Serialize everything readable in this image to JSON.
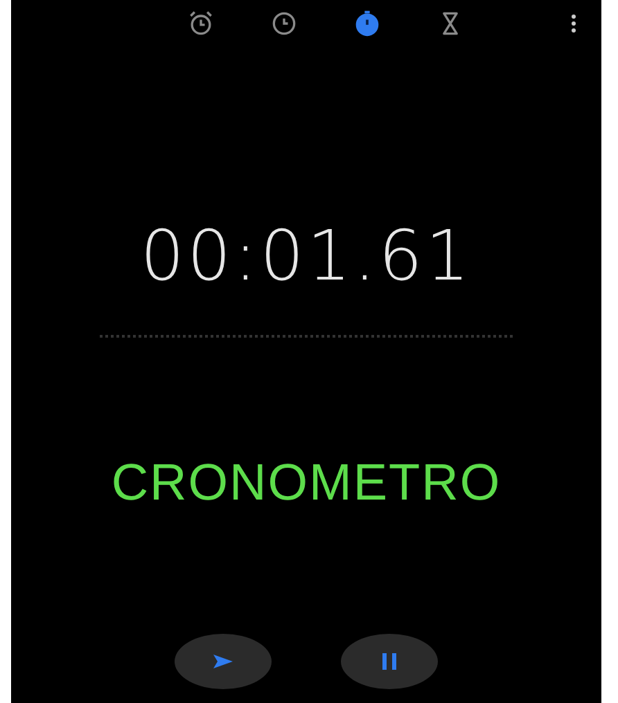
{
  "tabs": [
    {
      "kind": "alarm",
      "selected": false
    },
    {
      "kind": "clock",
      "selected": false
    },
    {
      "kind": "stopwatch",
      "selected": true
    },
    {
      "kind": "timer",
      "selected": false
    }
  ],
  "elapsed": "00:01.61",
  "caption": "CRONOMETRO",
  "buttons": [
    {
      "kind": "play"
    },
    {
      "kind": "pause"
    }
  ]
}
